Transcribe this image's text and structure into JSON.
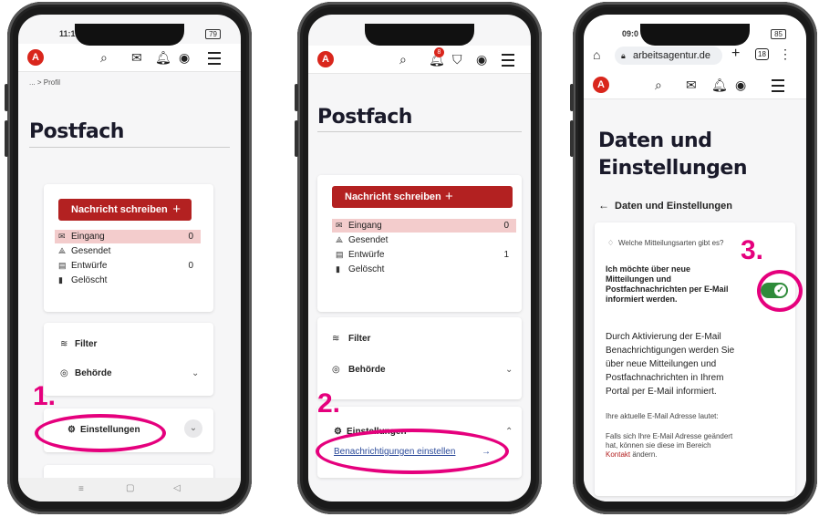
{
  "colors": {
    "accent_red": "#b32121",
    "highlight_pink": "#e5007d",
    "toggle_green": "#2e8b3a"
  },
  "phone1": {
    "status_time": "11:1",
    "status_battery": "79",
    "breadcrumb": "... > Profil",
    "title": "Postfach",
    "write_button": "Nachricht schreiben",
    "folders": [
      {
        "icon": "inbox-icon",
        "label": "Eingang",
        "count": "0"
      },
      {
        "icon": "sent-icon",
        "label": "Gesendet",
        "count": ""
      },
      {
        "icon": "draft-icon",
        "label": "Entwürfe",
        "count": "0"
      },
      {
        "icon": "trash-icon",
        "label": "Gelöscht",
        "count": ""
      }
    ],
    "filter_label": "Filter",
    "authority_label": "Behörde",
    "settings_label": "Einstellungen",
    "step": "1."
  },
  "phone2": {
    "bell_badge": "8",
    "title": "Postfach",
    "write_button": "Nachricht schreiben",
    "folders": [
      {
        "icon": "inbox-icon",
        "label": "Eingang",
        "count": "0"
      },
      {
        "icon": "sent-icon",
        "label": "Gesendet",
        "count": ""
      },
      {
        "icon": "draft-icon",
        "label": "Entwürfe",
        "count": "1"
      },
      {
        "icon": "trash-icon",
        "label": "Gelöscht",
        "count": ""
      }
    ],
    "filter_label": "Filter",
    "authority_label": "Behörde",
    "settings_label": "Einstellungen",
    "notifications_link": "Benachrichtigungen einstellen",
    "step": "2."
  },
  "phone3": {
    "status_time": "09:0",
    "status_battery": "85",
    "url": "arbeitsagentur.de",
    "tab_count": "18",
    "title_line1": "Daten und",
    "title_line2": "Einstellungen",
    "back_label": "Daten und Einstellungen",
    "question": "Welche Mitteilungsarten gibt es?",
    "option_text_1": "Ich möchte über neue",
    "option_text_2": "Mitteilungen und",
    "option_text_3": "Postfachnachrichten per E-Mail",
    "option_text_4": "informiert werden.",
    "desc_1": "Durch Aktivierung der E-Mail",
    "desc_2": "Benachrichtigungen werden Sie",
    "desc_3": "über neue Mitteilungen und",
    "desc_4": "Postfachnachrichten in Ihrem",
    "desc_5": "Portal per E-Mail informiert.",
    "current_email_label": "Ihre aktuelle E-Mail Adresse lautet:",
    "change_hint_1": "Falls sich Ihre E-Mail Adresse geändert",
    "change_hint_2": "hat, können sie diese im Bereich",
    "contact_link": "Kontakt",
    "change_hint_3": " ändern.",
    "step": "3."
  }
}
